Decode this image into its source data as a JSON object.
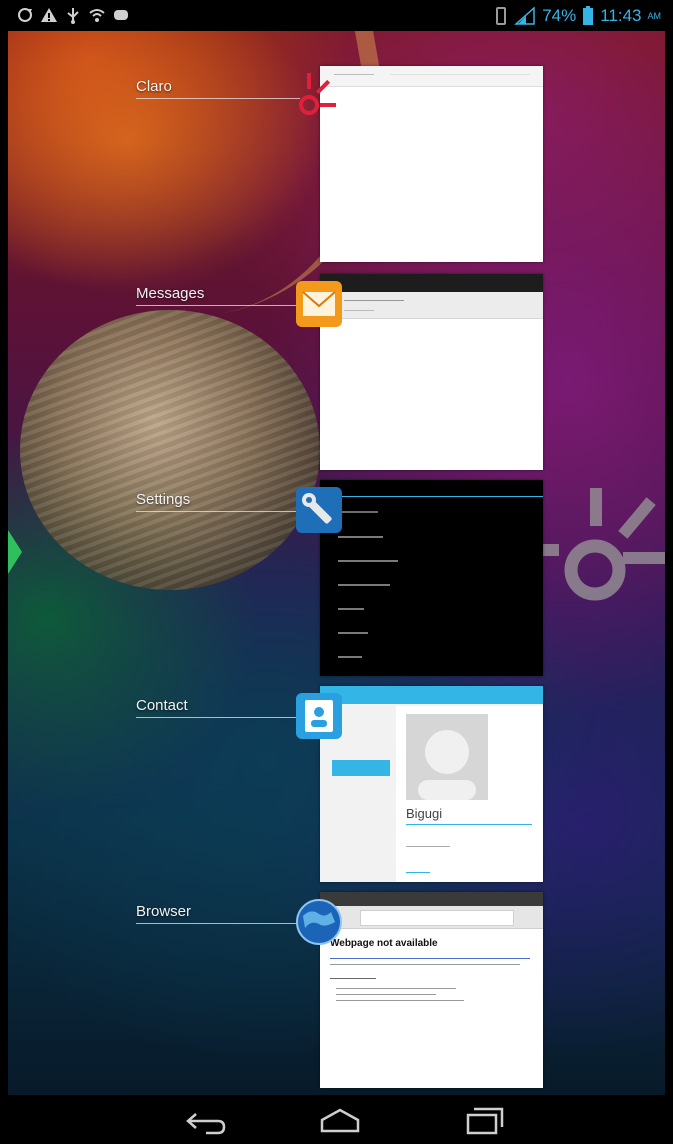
{
  "status_bar": {
    "icons": [
      "sync-icon",
      "warning-icon",
      "usb-icon",
      "wifi-icon",
      "bbm-icon",
      "vibrate-icon",
      "signal-icon",
      "battery-icon"
    ],
    "battery_percent": "74%",
    "time": "11:43",
    "ampm": "AM"
  },
  "recent_apps": [
    {
      "label": "Claro",
      "icon": "claro-logo-icon"
    },
    {
      "label": "Messages",
      "icon": "envelope-icon"
    },
    {
      "label": "Settings",
      "icon": "wrench-icon"
    },
    {
      "label": "Contact",
      "icon": "contact-card-icon"
    },
    {
      "label": "Browser",
      "icon": "globe-icon"
    }
  ],
  "contact_thumb": {
    "name": "Bigugi"
  },
  "browser_thumb": {
    "heading": "Webpage not available"
  },
  "nav_bar": {
    "buttons": [
      "back-icon",
      "home-icon",
      "recent-apps-icon"
    ]
  },
  "colors": {
    "status_accent": "#35b5e5",
    "claro_red": "#e0203a",
    "messages_orange": "#f39a1d",
    "settings_blue": "#1e6fb8",
    "contact_blue": "#2aa0e0",
    "thumb_header_blue": "#33b5e5"
  }
}
